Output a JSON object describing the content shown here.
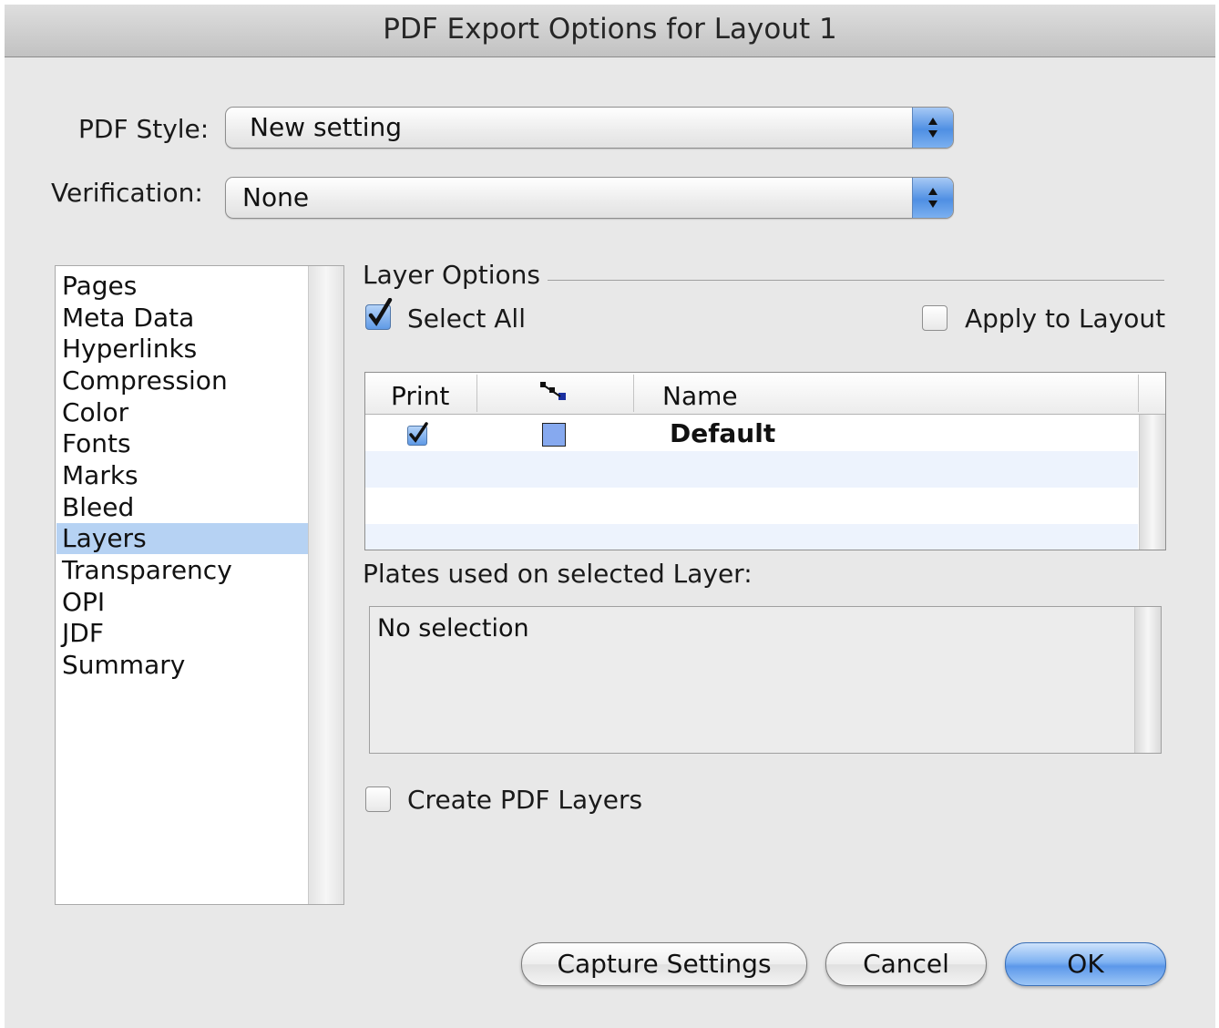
{
  "window": {
    "title": "PDF Export Options for Layout 1"
  },
  "pdf_style": {
    "label": "PDF Style:",
    "value": "New setting"
  },
  "verification": {
    "label": "Verification:",
    "value": "None"
  },
  "sidebar": {
    "items": [
      {
        "label": "Pages"
      },
      {
        "label": "Meta Data"
      },
      {
        "label": "Hyperlinks"
      },
      {
        "label": "Compression"
      },
      {
        "label": "Color"
      },
      {
        "label": "Fonts"
      },
      {
        "label": "Marks"
      },
      {
        "label": "Bleed"
      },
      {
        "label": "Layers",
        "selected": true
      },
      {
        "label": "Transparency"
      },
      {
        "label": "OPI"
      },
      {
        "label": "JDF"
      },
      {
        "label": "Summary"
      }
    ]
  },
  "layer_options": {
    "group_title": "Layer Options",
    "select_all": {
      "label": "Select All",
      "checked": true
    },
    "apply_to_layout": {
      "label": "Apply to Layout",
      "checked": false
    },
    "table": {
      "columns": {
        "print": "Print",
        "icon": "layer-icon",
        "name": "Name"
      },
      "rows": [
        {
          "print": true,
          "swatch_color": "#86a9ef",
          "name": "Default"
        }
      ]
    },
    "plates_label": "Plates used on selected Layer:",
    "plates_text": "No selection",
    "create_pdf_layers": {
      "label": "Create PDF Layers",
      "checked": false
    }
  },
  "buttons": {
    "capture": "Capture Settings",
    "cancel": "Cancel",
    "ok": "OK"
  },
  "colors": {
    "selection": "#b6d2f3",
    "accent": "#5c98ea"
  }
}
